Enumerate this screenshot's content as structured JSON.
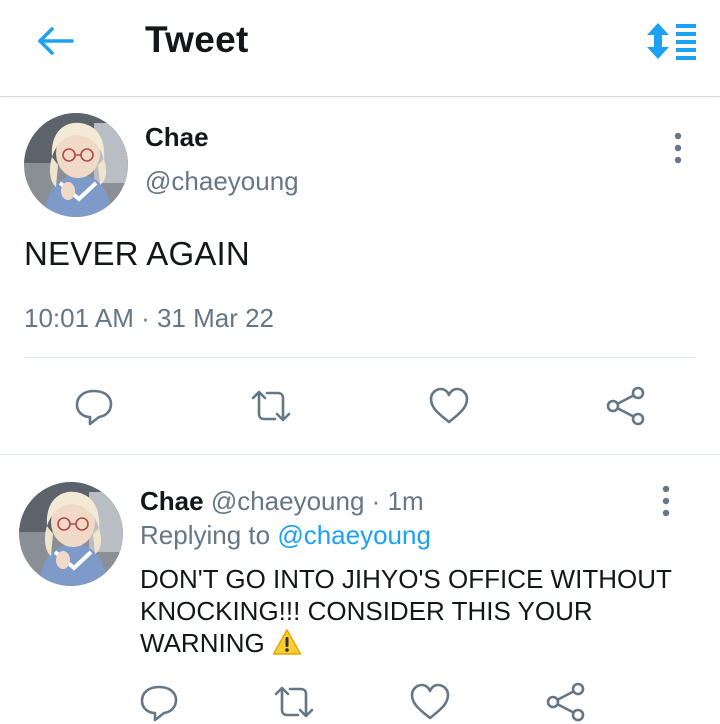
{
  "header": {
    "title": "Tweet",
    "back_icon": "back-arrow-icon",
    "sort_icon": "sort-timeline-icon",
    "accent_color": "#1da1f2"
  },
  "main_tweet": {
    "name": "Chae",
    "handle": "@chaeyoung",
    "text": "NEVER AGAIN",
    "meta": "10:01 AM · 31 Mar 22",
    "actions": [
      "reply-icon",
      "retweet-icon",
      "like-icon",
      "share-icon"
    ]
  },
  "reply_tweet": {
    "name": "Chae",
    "handle": "@chaeyoung",
    "separator": " · ",
    "time": "1m",
    "replying_prefix": "Replying to ",
    "replying_to": "@chaeyoung",
    "text": "DON'T GO INTO JIHYO'S OFFICE WITHOUT KNOCKING!!! CONSIDER THIS YOUR WARNING",
    "emoji_icon": "warning-icon",
    "actions": [
      "reply-icon",
      "retweet-icon",
      "like-icon",
      "share-icon"
    ]
  },
  "colors": {
    "secondary_text": "#657786",
    "icon_gray": "#657786",
    "divider": "#e1e8ed"
  }
}
